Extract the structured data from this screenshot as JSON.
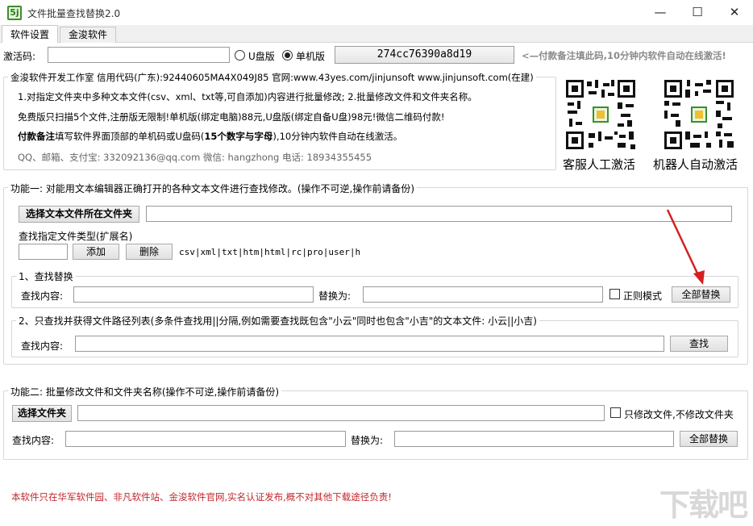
{
  "window": {
    "title": "文件批量查找替换2.0",
    "icon_text": "5j",
    "minimize": "—",
    "maximize": "☐",
    "close": "✕"
  },
  "tabs": [
    {
      "label": "软件设置"
    },
    {
      "label": "金浚软件"
    }
  ],
  "activation": {
    "label": "激活码:",
    "value": "",
    "radio_udisk": "U盘版",
    "radio_standalone": "单机版",
    "machine_code": "274cc76390a8d19",
    "tip": "<—付款备注填此码,10分钟内软件自动在线激活!"
  },
  "about": {
    "title": "金浚软件开发工作室 信用代码(广东):92440605MA4X049J85 官网:www.43yes.com/jinjunsoft  www.jinjunsoft.com(在建)",
    "line1": "1.对指定文件夹中多种文本文件(csv、xml、txt等,可自添加)内容进行批量修改; 2.批量修改文件和文件夹名称。",
    "line2": "免费版只扫描5个文件,注册版无限制!单机版(绑定电脑)88元,U盘版(绑定自备U盘)98元!微信二维码付款!",
    "line3_bold": "付款备注",
    "line3_mid": "填写软件界面顶部的单机码或U盘码(",
    "line3_bold2": "15个数字与字母",
    "line3_end": "),10分钟内软件自动在线激活。",
    "contact": "QQ、邮箱、支付宝: 332092136@qq.com    微信: hangzhong    电话: 18934355455",
    "qr_manual": "客服人工激活",
    "qr_robot": "机器人自动激活"
  },
  "func1": {
    "title": "功能一: 对能用文本编辑器正确打开的各种文本文件进行查找修改。(操作不可逆,操作前请备份)",
    "select_folder": "选择文本文件所在文件夹",
    "folder_path": "",
    "ext_label": "查找指定文件类型(扩展名)",
    "ext_value": "",
    "add": "添加",
    "delete": "删除",
    "ext_list": "csv|xml|txt|htm|html|rc|pro|user|h",
    "sub1_title": "1、查找替换",
    "find_label": "查找内容:",
    "find_value": "",
    "replace_label": "替换为:",
    "replace_value": "",
    "regex": "正则模式",
    "replace_all": "全部替换",
    "sub2_title": "2、只查找并获得文件路径列表(多条件查找用||分隔,例如需要查找既包含\"小云\"同时也包含\"小吉\"的文本文件: 小云||小吉)",
    "find2_label": "查找内容:",
    "find2_value": "",
    "find_btn": "查找"
  },
  "func2": {
    "title": "功能二: 批量修改文件和文件夹名称(操作不可逆,操作前请备份)",
    "select_folder": "选择文件夹",
    "folder_path": "",
    "only_files": "只修改文件,不修改文件夹",
    "find_label": "查找内容:",
    "find_value": "",
    "replace_label": "替换为:",
    "replace_value": "",
    "replace_all": "全部替换"
  },
  "footer": {
    "notice": "本软件只在华军软件园、非凡软件站、金浚软件官网,实名认证发布,概不对其他下载途径负责!"
  },
  "watermark": "下载吧",
  "colors": {
    "tip": "#8a8a8a",
    "notice": "#c0282d",
    "arrow": "#d42020"
  }
}
